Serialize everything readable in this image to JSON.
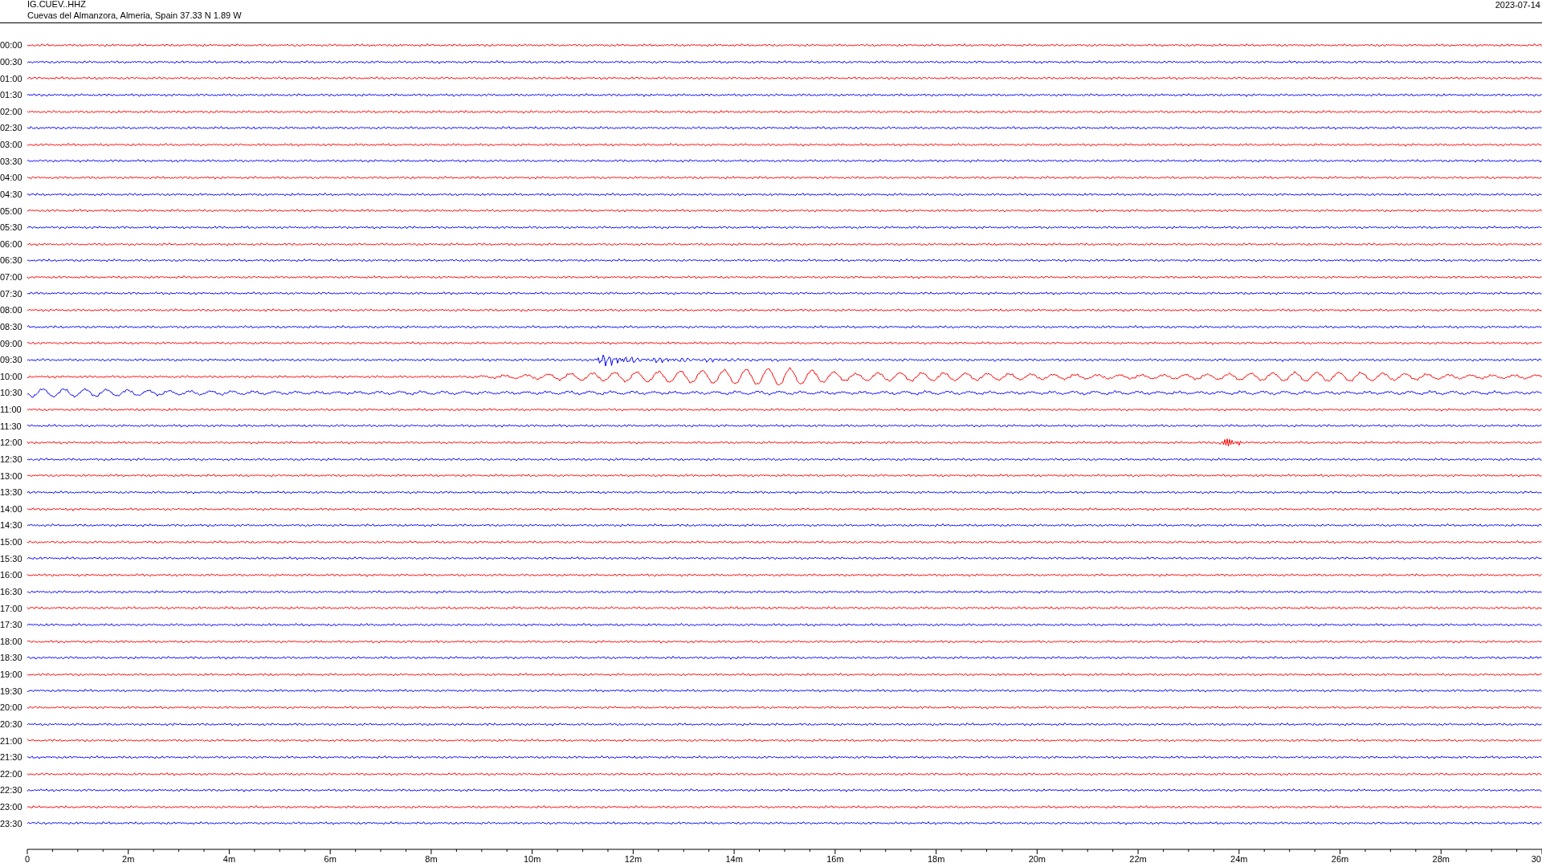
{
  "header": {
    "channel": "IG.CUEV..HHZ",
    "station": "Cuevas del Almanzora, Almeria, Spain  37.33 N 1.89 W",
    "date": "2023-07-14"
  },
  "traces": [
    {
      "label": "00:00",
      "color": "#ff0000"
    },
    {
      "label": "00:30",
      "color": "#0000ff"
    },
    {
      "label": "01:00",
      "color": "#ff0000"
    },
    {
      "label": "01:30",
      "color": "#0000ff"
    },
    {
      "label": "02:00",
      "color": "#ff0000"
    },
    {
      "label": "02:30",
      "color": "#0000ff"
    },
    {
      "label": "03:00",
      "color": "#ff0000"
    },
    {
      "label": "03:30",
      "color": "#0000ff"
    },
    {
      "label": "04:00",
      "color": "#ff0000"
    },
    {
      "label": "04:30",
      "color": "#0000ff"
    },
    {
      "label": "05:00",
      "color": "#ff0000"
    },
    {
      "label": "05:30",
      "color": "#0000ff"
    },
    {
      "label": "06:00",
      "color": "#ff0000"
    },
    {
      "label": "06:30",
      "color": "#0000ff"
    },
    {
      "label": "07:00",
      "color": "#ff0000"
    },
    {
      "label": "07:30",
      "color": "#0000ff"
    },
    {
      "label": "08:00",
      "color": "#ff0000"
    },
    {
      "label": "08:30",
      "color": "#0000ff"
    },
    {
      "label": "09:00",
      "color": "#ff0000"
    },
    {
      "label": "09:30",
      "color": "#0000ff"
    },
    {
      "label": "10:00",
      "color": "#ff0000"
    },
    {
      "label": "10:30",
      "color": "#0000ff"
    },
    {
      "label": "11:00",
      "color": "#ff0000"
    },
    {
      "label": "11:30",
      "color": "#0000ff"
    },
    {
      "label": "12:00",
      "color": "#ff0000"
    },
    {
      "label": "12:30",
      "color": "#0000ff"
    },
    {
      "label": "13:00",
      "color": "#ff0000"
    },
    {
      "label": "13:30",
      "color": "#0000ff"
    },
    {
      "label": "14:00",
      "color": "#ff0000"
    },
    {
      "label": "14:30",
      "color": "#0000ff"
    },
    {
      "label": "15:00",
      "color": "#ff0000"
    },
    {
      "label": "15:30",
      "color": "#0000ff"
    },
    {
      "label": "16:00",
      "color": "#ff0000"
    },
    {
      "label": "16:30",
      "color": "#0000ff"
    },
    {
      "label": "17:00",
      "color": "#ff0000"
    },
    {
      "label": "17:30",
      "color": "#0000ff"
    },
    {
      "label": "18:00",
      "color": "#ff0000"
    },
    {
      "label": "18:30",
      "color": "#0000ff"
    },
    {
      "label": "19:00",
      "color": "#ff0000"
    },
    {
      "label": "19:30",
      "color": "#0000ff"
    },
    {
      "label": "20:00",
      "color": "#ff0000"
    },
    {
      "label": "20:30",
      "color": "#0000ff"
    },
    {
      "label": "21:00",
      "color": "#ff0000"
    },
    {
      "label": "21:30",
      "color": "#0000ff"
    },
    {
      "label": "22:00",
      "color": "#ff0000"
    },
    {
      "label": "22:30",
      "color": "#0000ff"
    },
    {
      "label": "23:00",
      "color": "#ff0000"
    },
    {
      "label": "23:30",
      "color": "#0000ff"
    }
  ],
  "x_axis": {
    "labels": [
      "0",
      "2m",
      "4m",
      "6m",
      "8m",
      "10m",
      "12m",
      "14m",
      "16m",
      "18m",
      "20m",
      "22m",
      "24m",
      "26m",
      "28m",
      "30"
    ]
  }
}
